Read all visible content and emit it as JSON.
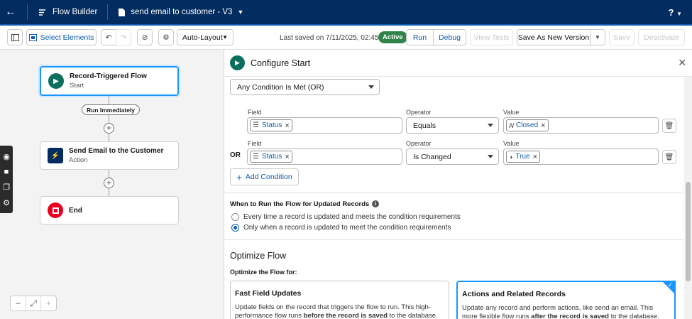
{
  "topbar": {
    "app_name": "Flow Builder",
    "flow_name": "send email to customer - V3",
    "help": "?"
  },
  "toolbar": {
    "select_elements": "Select Elements",
    "layout": "Auto-Layout",
    "last_saved": "Last saved on 7/11/2025, 02:45 PM",
    "status": "Active",
    "run": "Run",
    "debug": "Debug",
    "view_tests": "View Tests",
    "save_as_new_version": "Save As New Version",
    "save": "Save",
    "deactivate": "Deactivate"
  },
  "canvas": {
    "start_node": {
      "title": "Record-Triggered Flow",
      "subtitle": "Start"
    },
    "run_pill": "Run Immediately",
    "action_node": {
      "title": "Send Email to the Customer",
      "subtitle": "Action"
    },
    "end_node": {
      "title": "End"
    }
  },
  "panel": {
    "title": "Configure Start",
    "condition_logic": "Any Condition Is Met (OR)",
    "conditions": [
      {
        "prefix": "",
        "field_label": "Field",
        "field": "Status",
        "operator_label": "Operator",
        "operator": "Equals",
        "value_label": "Value",
        "value": "Closed"
      },
      {
        "prefix": "OR",
        "field_label": "Field",
        "field": "Status",
        "operator_label": "Operator",
        "operator": "Is Changed",
        "value_label": "Value",
        "value": "True"
      }
    ],
    "add_condition": "Add Condition",
    "when_to_run_label": "When to Run the Flow for Updated Records",
    "run_options": [
      {
        "label": "Every time a record is updated and meets the condition requirements",
        "selected": false
      },
      {
        "label": "Only when a record is updated to meet the condition requirements",
        "selected": true
      }
    ],
    "optimize_title": "Optimize Flow",
    "optimize_for_label": "Optimize the Flow for:",
    "cards": [
      {
        "title": "Fast Field Updates",
        "desc_pre": "Update fields on the record that triggers the flow to run. This high-performance flow runs ",
        "desc_bold": "before the record is saved",
        "desc_post": " to the database.",
        "selected": false
      },
      {
        "title": "Actions and Related Records",
        "desc_pre": "Update any record and perform actions, like send an email. This more flexible flow runs ",
        "desc_bold": "after the record is saved",
        "desc_post": " to the database.",
        "selected": true
      }
    ]
  },
  "colors": {
    "header": "#032d60",
    "brand_blue": "#0b5cab",
    "active_green": "#2e844a",
    "selected_border": "#1b96ff"
  }
}
